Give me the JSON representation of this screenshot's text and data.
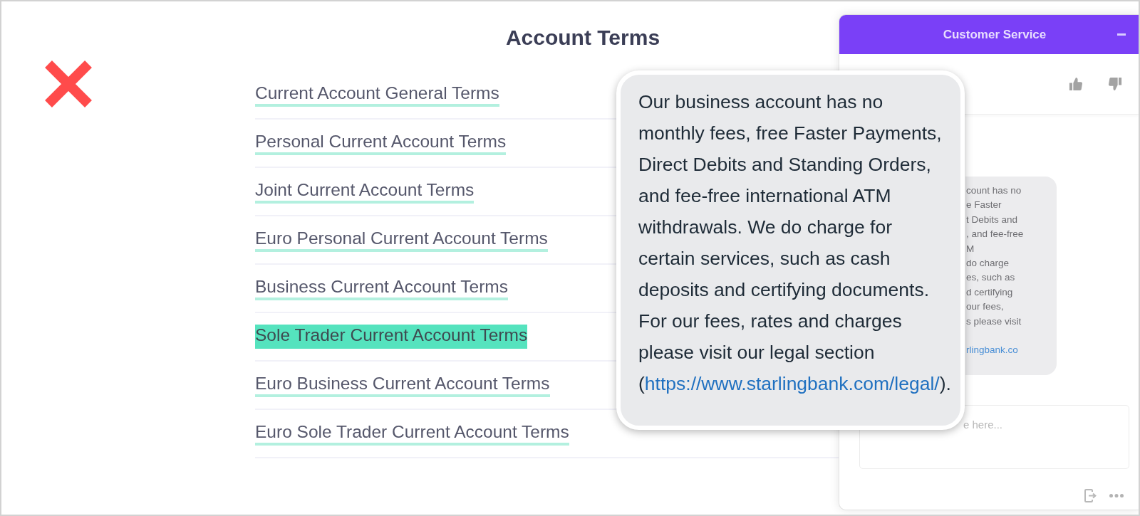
{
  "page": {
    "title": "Account Terms",
    "links": [
      {
        "label": "Current Account General Terms",
        "selected": false
      },
      {
        "label": "Personal Current Account Terms",
        "selected": false
      },
      {
        "label": "Joint Current Account Terms",
        "selected": false
      },
      {
        "label": "Euro Personal Current Account Terms",
        "selected": false
      },
      {
        "label": "Business Current Account Terms",
        "selected": false
      },
      {
        "label": "Sole Trader Current Account Terms",
        "selected": true
      },
      {
        "label": "Euro Business Current Account Terms",
        "selected": false
      },
      {
        "label": "Euro Sole Trader Current Account Terms",
        "selected": false
      }
    ]
  },
  "chat": {
    "title": "Customer Service",
    "message_fragments": [
      {
        "kind": "text",
        "text": "count has no"
      },
      {
        "kind": "text",
        "text": "e Faster"
      },
      {
        "kind": "text",
        "text": "t Debits and"
      },
      {
        "kind": "text",
        "text": ", and fee-free"
      },
      {
        "kind": "text",
        "text": "M"
      },
      {
        "kind": "text",
        "text": "do charge"
      },
      {
        "kind": "text",
        "text": "es, such as"
      },
      {
        "kind": "text",
        "text": "d certifying"
      },
      {
        "kind": "text",
        "text": "our fees,"
      },
      {
        "kind": "text",
        "text": "s please visit"
      },
      {
        "kind": "link",
        "text": "rlingbank.co"
      }
    ],
    "input": {
      "placeholder": "e here..."
    }
  },
  "zoomed_message": {
    "text": "Our business account has no monthly fees, free Faster Payments, Direct Debits and Standing Orders, and fee-free international ATM withdrawals. We do charge for certain services, such as cash deposits and certifying documents. For our fees, rates and charges please visit our legal section (",
    "link": "https://www.starlingbank.com/legal/",
    "text_end": ")."
  }
}
